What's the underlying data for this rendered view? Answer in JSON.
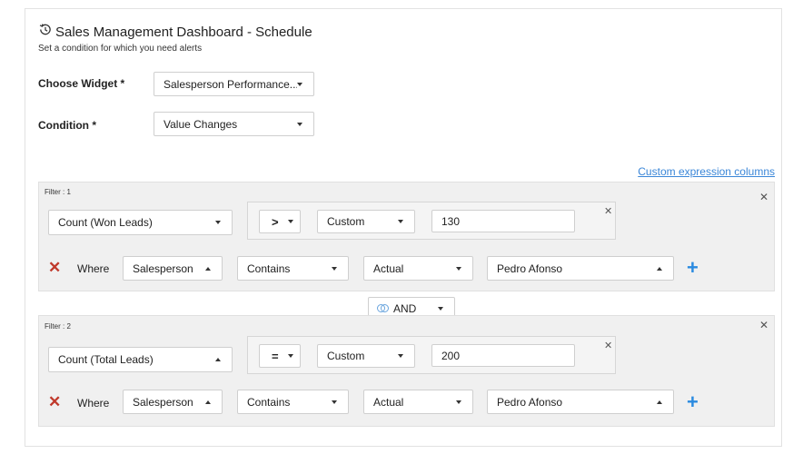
{
  "header": {
    "title": "Sales Management Dashboard - Schedule",
    "subtitle": "Set a condition for which you need alerts"
  },
  "widget": {
    "label": "Choose Widget *",
    "value": "Salesperson Performance..."
  },
  "condition": {
    "label": "Condition  *",
    "value": "Value Changes"
  },
  "custom_expression_link": "Custom expression columns",
  "filters": [
    {
      "label": "Filter : 1",
      "measure": "Count (Won Leads)",
      "operator": ">",
      "value_type": "Custom",
      "value": "130",
      "where": {
        "label": "Where",
        "field": "Salesperson",
        "match": "Contains",
        "mode": "Actual",
        "value": "Pedro Afonso"
      }
    },
    {
      "label": "Filter : 2",
      "measure": "Count (Total Leads)",
      "operator": "=",
      "value_type": "Custom",
      "value": "200",
      "where": {
        "label": "Where",
        "field": "Salesperson",
        "match": "Contains",
        "mode": "Actual",
        "value": "Pedro Afonso"
      }
    }
  ],
  "conjunction": "AND",
  "icons": {
    "history": "history-clock-icon",
    "close": "close-icon",
    "remove": "remove-row-icon",
    "add": "add-row-icon",
    "and": "intersect-circles-icon"
  },
  "colors": {
    "link": "#3a86d8",
    "remove": "#c0392b",
    "add": "#2a8ae0",
    "filter_bg": "#f0f0f0"
  }
}
